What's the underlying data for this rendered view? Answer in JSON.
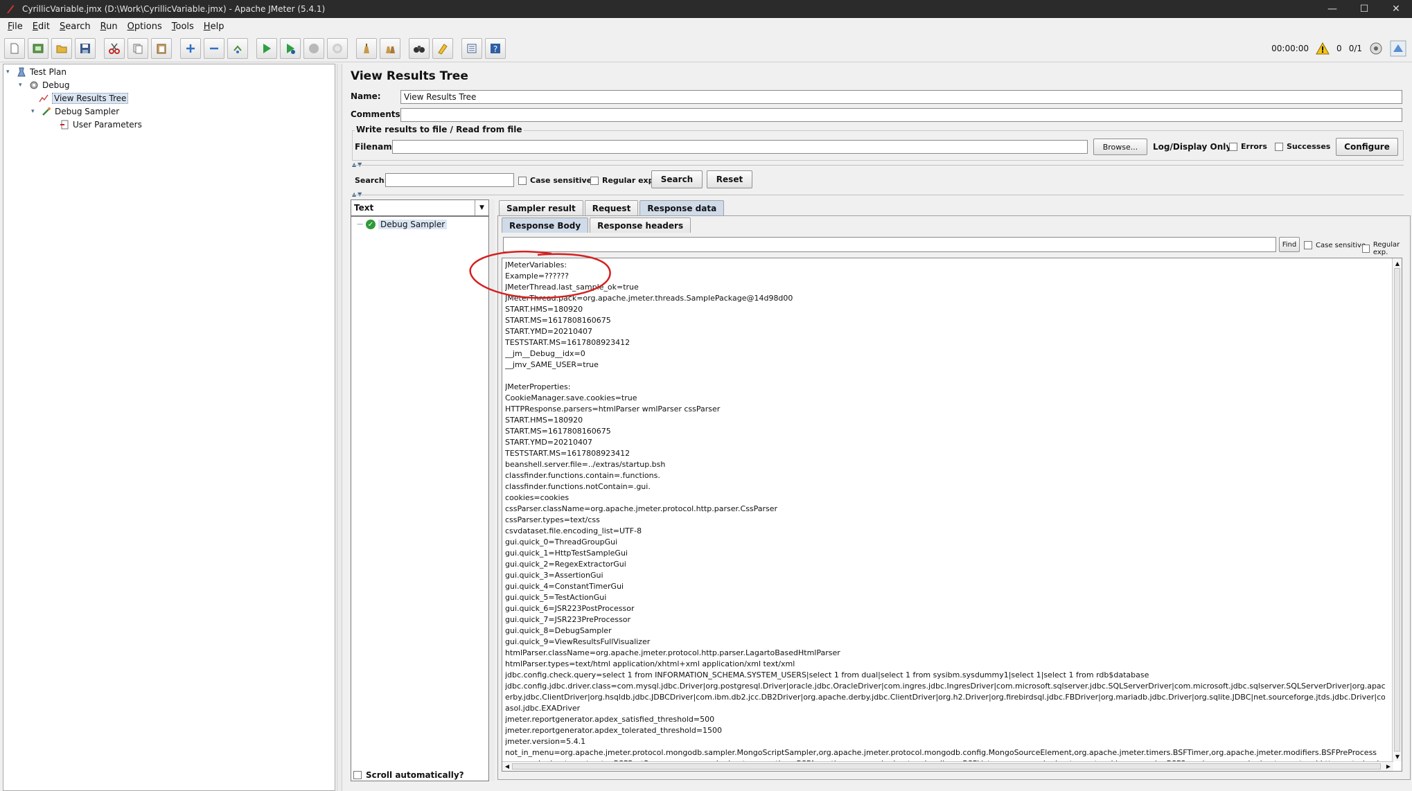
{
  "window": {
    "title": "CyrillicVariable.jmx (D:\\Work\\CyrillicVariable.jmx) - Apache JMeter (5.4.1)",
    "controls": [
      "—",
      "☐",
      "✕"
    ]
  },
  "menubar": {
    "items": [
      {
        "underline": "F",
        "rest": "ile"
      },
      {
        "underline": "E",
        "rest": "dit"
      },
      {
        "underline": "S",
        "rest": "earch"
      },
      {
        "underline": "R",
        "rest": "un"
      },
      {
        "underline": "O",
        "rest": "ptions"
      },
      {
        "underline": "T",
        "rest": "ools"
      },
      {
        "underline": "H",
        "rest": "elp"
      }
    ]
  },
  "toolbar": {
    "timer": "00:00:00",
    "warnings": "0",
    "threads": "0/1"
  },
  "tree": {
    "nodes": [
      {
        "label": "Test Plan"
      },
      {
        "label": "Debug"
      },
      {
        "label": "View Results Tree"
      },
      {
        "label": "Debug Sampler"
      },
      {
        "label": "User Parameters"
      }
    ]
  },
  "panel": {
    "title": "View Results Tree",
    "name_label": "Name:",
    "name_value": "View Results Tree",
    "comments_label": "Comments:",
    "comments_value": "",
    "file_group_title": "Write results to file / Read from file",
    "filename_label": "Filename",
    "filename_value": "",
    "browse_label": "Browse...",
    "log_display_label": "Log/Display Only:",
    "errors_label": "Errors",
    "successes_label": "Successes",
    "configure_label": "Configure",
    "search_label": "Search:",
    "search_value": "",
    "case_sensitive_label": "Case sensitive",
    "regex_label": "Regular exp.",
    "search_button": "Search",
    "reset_button": "Reset"
  },
  "results": {
    "renderer": "Text",
    "items": [
      {
        "label": "Debug Sampler",
        "status": "success"
      }
    ],
    "scroll_auto_label": "Scroll automatically?"
  },
  "tabs": {
    "main": [
      "Sampler result",
      "Request",
      "Response data"
    ],
    "active_main": "Response data",
    "sub": [
      "Response Body",
      "Response headers"
    ],
    "active_sub": "Response Body"
  },
  "find": {
    "value": "",
    "button": "Find",
    "case_sensitive_label": "Case sensitive",
    "regex_label": "Regular exp."
  },
  "response": {
    "body": "JMeterVariables:\nExample=??????\nJMeterThread.last_sample_ok=true\nJMeterThread.pack=org.apache.jmeter.threads.SamplePackage@14d98d00\nSTART.HMS=180920\nSTART.MS=1617808160675\nSTART.YMD=20210407\nTESTSTART.MS=1617808923412\n__jm__Debug__idx=0\n__jmv_SAME_USER=true\n\nJMeterProperties:\nCookieManager.save.cookies=true\nHTTPResponse.parsers=htmlParser wmlParser cssParser\nSTART.HMS=180920\nSTART.MS=1617808160675\nSTART.YMD=20210407\nTESTSTART.MS=1617808923412\nbeanshell.server.file=../extras/startup.bsh\nclassfinder.functions.contain=.functions.\nclassfinder.functions.notContain=.gui.\ncookies=cookies\ncssParser.className=org.apache.jmeter.protocol.http.parser.CssParser\ncssParser.types=text/css\ncsvdataset.file.encoding_list=UTF-8\ngui.quick_0=ThreadGroupGui\ngui.quick_1=HttpTestSampleGui\ngui.quick_2=RegexExtractorGui\ngui.quick_3=AssertionGui\ngui.quick_4=ConstantTimerGui\ngui.quick_5=TestActionGui\ngui.quick_6=JSR223PostProcessor\ngui.quick_7=JSR223PreProcessor\ngui.quick_8=DebugSampler\ngui.quick_9=ViewResultsFullVisualizer\nhtmlParser.className=org.apache.jmeter.protocol.http.parser.LagartoBasedHtmlParser\nhtmlParser.types=text/html application/xhtml+xml application/xml text/xml\njdbc.config.check.query=select 1 from INFORMATION_SCHEMA.SYSTEM_USERS|select 1 from dual|select 1 from sysibm.sysdummy1|select 1|select 1 from rdb$database\njdbc.config.jdbc.driver.class=com.mysql.jdbc.Driver|org.postgresql.Driver|oracle.jdbc.OracleDriver|com.ingres.jdbc.IngresDriver|com.microsoft.sqlserver.jdbc.SQLServerDriver|com.microsoft.jdbc.sqlserver.SQLServerDriver|org.apache\nerby.jdbc.ClientDriver|org.hsqldb.jdbc.JDBCDriver|com.ibm.db2.jcc.DB2Driver|org.apache.derby.jdbc.ClientDriver|org.h2.Driver|org.firebirdsql.jdbc.FBDriver|org.mariadb.jdbc.Driver|org.sqlite.JDBC|net.sourceforge.jtds.jdbc.Driver|com.e\nasol.jdbc.EXADriver\njmeter.reportgenerator.apdex_satisfied_threshold=500\njmeter.reportgenerator.apdex_tolerated_threshold=1500\njmeter.version=5.4.1\nnot_in_menu=org.apache.jmeter.protocol.mongodb.sampler.MongoScriptSampler,org.apache.jmeter.protocol.mongodb.config.MongoSourceElement,org.apache.jmeter.timers.BSFTimer,org.apache.jmeter.modifiers.BSFPreProcess\norg.apache.jmeter.extractor.BSFPostProcessor,org.apache.jmeter.assertions.BSFAssertion,org.apache.jmeter.visualizers.BSFListener,org.apache.jmeter.protocol.java.sampler.BSFSampler,org.apache.jmeter.protocol.http.control.gui."
  },
  "colors": {
    "annotation": "#d42020",
    "selection": "#dbe6f4",
    "success": "#2e9a3a"
  }
}
